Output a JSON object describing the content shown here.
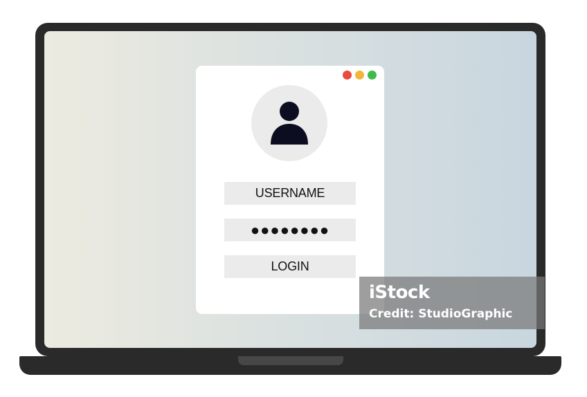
{
  "login_window": {
    "window_controls": {
      "close_color": "#e84a3c",
      "minimize_color": "#f3b63a",
      "maximize_color": "#3fbb4c"
    },
    "avatar_icon": "user-icon",
    "username_field": "USERNAME",
    "password_field": "●●●●●●●●",
    "login_button": "LOGIN"
  },
  "watermark": {
    "logo_text": "iStock",
    "credit_text": "Credit: StudioGraphic"
  },
  "colors": {
    "laptop_body": "#2a2a2a",
    "screen_gradient_left": "#ecebe0",
    "screen_gradient_right": "#c8d6df",
    "field_background": "#ebebeb"
  }
}
